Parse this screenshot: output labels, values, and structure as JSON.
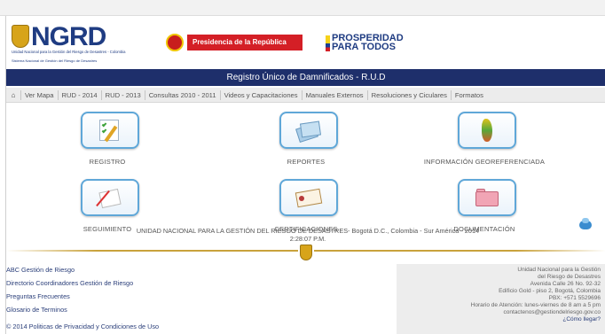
{
  "header": {
    "ngrd_logo_text": "NGRD",
    "ngrd_subtitle": "Unidad Nacional para la Gestión del Riesgo de Desastres - Colombia",
    "ngrd_system": "Sistema Nacional de Gestión del Riesgo de Desastres",
    "presidencia": "Presidencia de la República",
    "prosperidad_line1": "PROSPERIDAD",
    "prosperidad_line2": "PARA TODOS"
  },
  "title": "Registro Único de Damnificados - R.U.D",
  "nav": {
    "home_icon": "home-icon",
    "items": [
      "Ver Mapa",
      "RUD - 2014",
      "RUD - 2013",
      "Consultas 2010 - 2011",
      "Videos y Capacitaciones",
      "Manuales Externos",
      "Resoluciones y Ciculares",
      "Formatos"
    ]
  },
  "tiles": [
    {
      "label": "REGISTRO",
      "icon": "registro-icon"
    },
    {
      "label": "REPORTES",
      "icon": "reportes-icon"
    },
    {
      "label": "INFORMACIÓN GEOREFERENCIADA",
      "icon": "map-icon"
    },
    {
      "label": "SEGUIMIENTO",
      "icon": "seguimiento-icon"
    },
    {
      "label": "CERTIFICACIONES",
      "icon": "certificate-icon"
    },
    {
      "label": "DOCUMENTACIÓN",
      "icon": "folder-icon"
    }
  ],
  "footer_line1": "UNIDAD NACIONAL PARA LA GESTIÓN DEL RIESGO DE DESASTRES- Bogotá D.C., Colombia - Sur América - 2014",
  "footer_line2": "2:28:07 P.M.",
  "links": [
    "ABC Gestión de Riesgo",
    "Directorio Coordinadores Gestión de Riesgo",
    "Preguntas Frecuentes",
    "Glosario de Terminos"
  ],
  "copyright": "© 2014 Politicas de Privacidad y Condiciones de Uso",
  "contact": {
    "line1": "Unidad Nacional para la Gestión",
    "line2": "del Riesgo de Desastres",
    "line3": "Avenida Calle 26 No. 92-32",
    "line4": "Edificio Gold - piso 2, Bogotá, Colombia",
    "line5": "PBX: +571 5529696",
    "line6": "Horario de Atención: lunes-viernes de 8 am a 5 pm",
    "line7": "contactenos@gestiondelriesgo.gov.co",
    "location": "¿Cómo llegar?"
  },
  "colors": {
    "title_bar": "#1e2f6b",
    "tile_border": "#5fa7d8",
    "link": "#2b3f7a",
    "gold": "#c9a23c"
  }
}
